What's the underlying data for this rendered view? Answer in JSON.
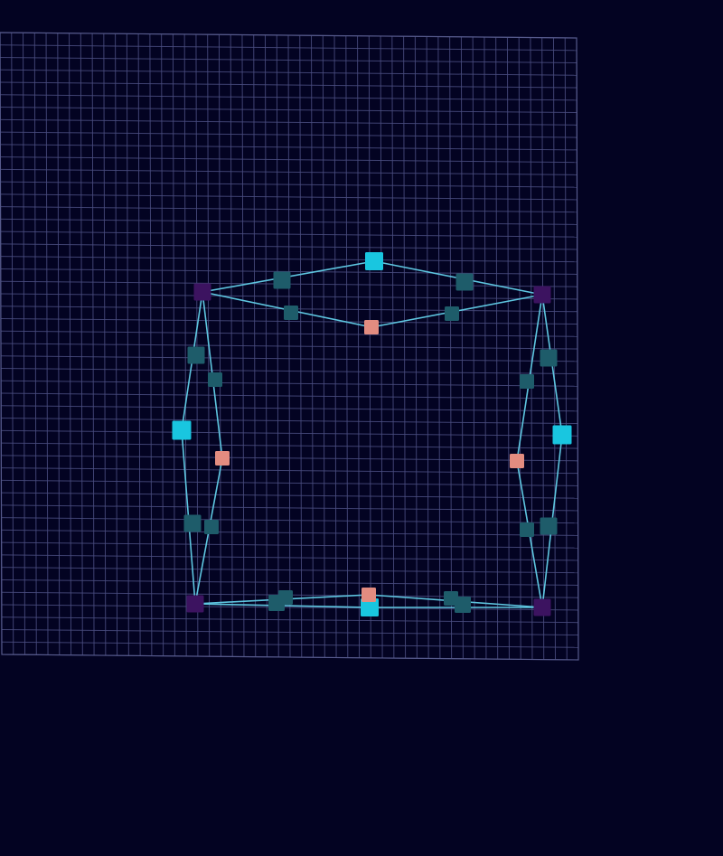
{
  "canvas": {
    "background": "#030322",
    "grid_color": "#4a4d80",
    "grid_divisions": 50
  },
  "colors": {
    "edge": "#5ec6e0",
    "corner": "#3c1360",
    "midpoint": "#19c6e0",
    "tangent": "#1e5c6a",
    "inner_midpoint": "#e38c80"
  },
  "handle_types": [
    "corner",
    "midpoint",
    "tangent",
    "inner-midpoint"
  ]
}
